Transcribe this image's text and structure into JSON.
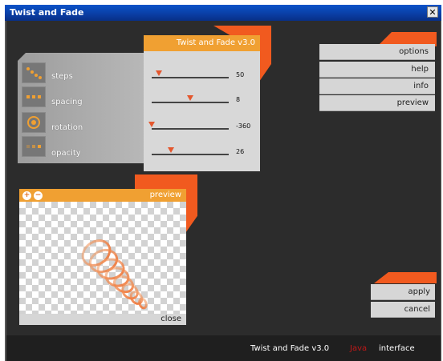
{
  "window": {
    "title": "Twist and Fade"
  },
  "settings_panel": {
    "title": "Twist and Fade v3.0",
    "params": [
      {
        "label": "steps",
        "value": "50",
        "position": 0.1
      },
      {
        "label": "spacing",
        "value": "8",
        "position": 0.52
      },
      {
        "label": "rotation",
        "value": "-360",
        "position": 0.0
      },
      {
        "label": "opacity",
        "value": "26",
        "position": 0.26
      }
    ]
  },
  "menu": {
    "items": [
      "options",
      "help",
      "info",
      "preview"
    ]
  },
  "preview_panel": {
    "title": "preview",
    "close_label": "close"
  },
  "actions": {
    "apply_label": "apply",
    "cancel_label": "cancel"
  },
  "footer": {
    "version": "Twist and Fade v3.0",
    "logo_text": "Java",
    "suffix": "interface"
  },
  "colors": {
    "accent": "#f15a1f",
    "header": "#f0a032",
    "background": "#2c2c2c"
  }
}
